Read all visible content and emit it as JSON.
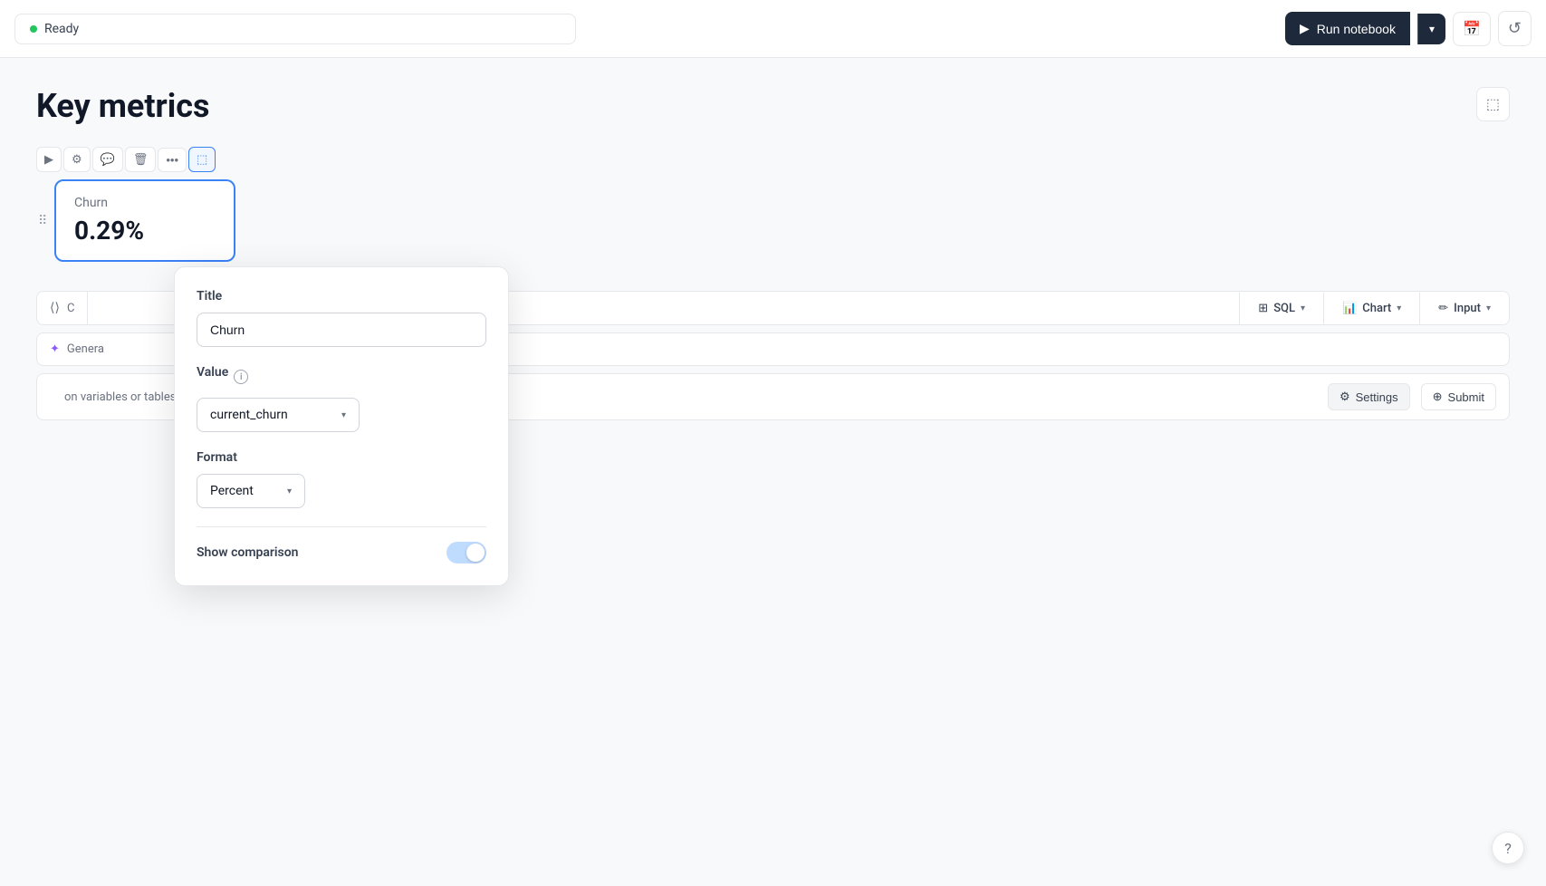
{
  "topbar": {
    "status_dot_color": "#22c55e",
    "status_label": "Ready",
    "run_btn_label": "Run notebook",
    "run_btn_dropdown_char": "▾",
    "calendar_icon": "📅",
    "refresh_icon": "↺"
  },
  "page": {
    "title": "Key metrics",
    "display_icon": "▭"
  },
  "toolbar": {
    "run_icon": "▶",
    "settings_icon": "⚙",
    "comment_icon": "💬",
    "trash_icon": "🗑",
    "more_icon": "•••",
    "display_icon": "▭"
  },
  "metric_card": {
    "drag_icon": "⠿",
    "title": "Churn",
    "value": "0.29%"
  },
  "cell_action_row": {
    "code_icon": "⟨⟩",
    "label": "C",
    "sql_icon": "⊞",
    "sql_label": "SQL",
    "chart_icon": "📊",
    "chart_label": "Chart",
    "input_icon": "✏",
    "input_label": "Input"
  },
  "generate_row": {
    "spark_icon": "✦",
    "label": "Genera"
  },
  "settings_submit": {
    "variables_text": "on variables or tables",
    "settings_icon": "⚙",
    "settings_label": "Settings",
    "submit_icon": "⊕",
    "submit_label": "Submit"
  },
  "popup": {
    "title_section_label": "Title",
    "title_input_value": "Churn",
    "title_input_placeholder": "Churn",
    "value_section_label": "Value",
    "value_info_icon": "i",
    "value_selected": "current_churn",
    "value_chevron": "▾",
    "format_section_label": "Format",
    "format_selected": "Percent",
    "format_chevron": "▾",
    "show_comparison_label": "Show comparison",
    "toggle_state": "on"
  },
  "help": {
    "icon": "?"
  }
}
